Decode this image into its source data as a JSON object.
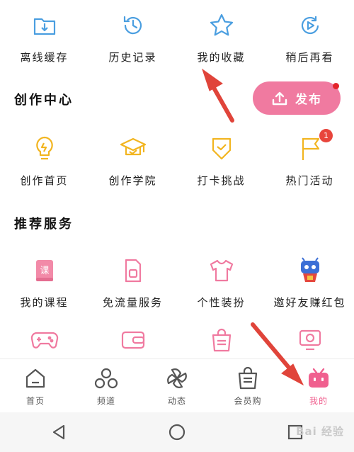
{
  "top_row": [
    {
      "label": "离线缓存",
      "icon": "download-folder-icon"
    },
    {
      "label": "历史记录",
      "icon": "clock-history-icon"
    },
    {
      "label": "我的收藏",
      "icon": "star-icon"
    },
    {
      "label": "稍后再看",
      "icon": "play-later-icon"
    }
  ],
  "creation": {
    "title": "创作中心",
    "publish_label": "发布",
    "items": [
      {
        "label": "创作首页",
        "icon": "lightbulb-icon"
      },
      {
        "label": "创作学院",
        "icon": "graduation-cap-icon"
      },
      {
        "label": "打卡挑战",
        "icon": "shield-check-icon"
      },
      {
        "label": "热门活动",
        "icon": "flag-icon",
        "badge": "1"
      }
    ]
  },
  "services": {
    "title": "推荐服务",
    "items": [
      {
        "label": "我的课程",
        "icon": "course-book-icon"
      },
      {
        "label": "免流量服务",
        "icon": "sim-card-icon"
      },
      {
        "label": "个性装扮",
        "icon": "tshirt-icon"
      },
      {
        "label": "邀好友赚红包",
        "icon": "mascot-icon"
      }
    ],
    "items_row2": [
      {
        "icon": "gamepad-icon"
      },
      {
        "icon": "wallet-icon"
      },
      {
        "icon": "shopping-bag-icon"
      },
      {
        "icon": "screen-icon"
      }
    ]
  },
  "bottom_nav": [
    {
      "label": "首页",
      "icon": "home-icon"
    },
    {
      "label": "频道",
      "icon": "channels-icon"
    },
    {
      "label": "动态",
      "icon": "pinwheel-icon"
    },
    {
      "label": "会员购",
      "icon": "member-shop-bag-icon"
    },
    {
      "label": "我的",
      "icon": "tv-mascot-icon",
      "active": true
    }
  ],
  "watermark": "Bai 经验",
  "colors": {
    "accent_pink": "#f07aa0",
    "blue_icon": "#4a9ee0",
    "yellow_icon": "#f2b520",
    "arrow_red": "#e0443a"
  }
}
